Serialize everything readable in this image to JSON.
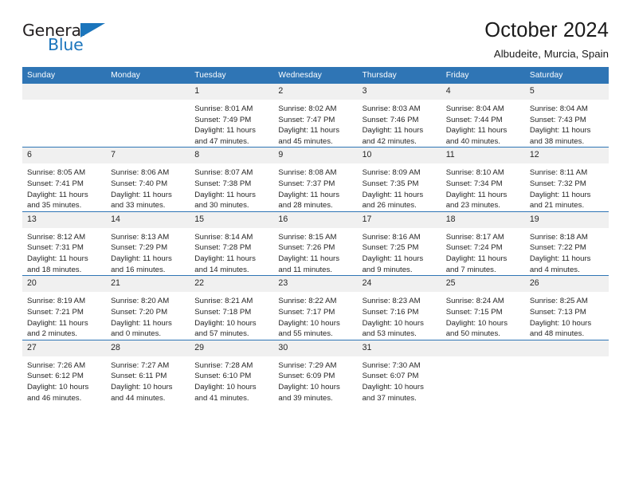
{
  "logo": {
    "word_top": "General",
    "word_bottom": "Blue",
    "triangle_color": "#1b75bc"
  },
  "header": {
    "title": "October 2024",
    "subtitle": "Albudeite, Murcia, Spain"
  },
  "colors": {
    "header_blue": "#2f75b5",
    "daynum_band": "#f0f0f0",
    "text": "#262626"
  },
  "weekday_headers": [
    "Sunday",
    "Monday",
    "Tuesday",
    "Wednesday",
    "Thursday",
    "Friday",
    "Saturday"
  ],
  "labels": {
    "sunrise": "Sunrise:",
    "sunset": "Sunset:",
    "daylight": "Daylight:"
  },
  "weeks": [
    [
      {
        "day": "",
        "empty": true
      },
      {
        "day": "",
        "empty": true
      },
      {
        "day": "1",
        "sunrise": "Sunrise: 8:01 AM",
        "sunset": "Sunset: 7:49 PM",
        "daylight1": "Daylight: 11 hours",
        "daylight2": "and 47 minutes."
      },
      {
        "day": "2",
        "sunrise": "Sunrise: 8:02 AM",
        "sunset": "Sunset: 7:47 PM",
        "daylight1": "Daylight: 11 hours",
        "daylight2": "and 45 minutes."
      },
      {
        "day": "3",
        "sunrise": "Sunrise: 8:03 AM",
        "sunset": "Sunset: 7:46 PM",
        "daylight1": "Daylight: 11 hours",
        "daylight2": "and 42 minutes."
      },
      {
        "day": "4",
        "sunrise": "Sunrise: 8:04 AM",
        "sunset": "Sunset: 7:44 PM",
        "daylight1": "Daylight: 11 hours",
        "daylight2": "and 40 minutes."
      },
      {
        "day": "5",
        "sunrise": "Sunrise: 8:04 AM",
        "sunset": "Sunset: 7:43 PM",
        "daylight1": "Daylight: 11 hours",
        "daylight2": "and 38 minutes."
      }
    ],
    [
      {
        "day": "6",
        "sunrise": "Sunrise: 8:05 AM",
        "sunset": "Sunset: 7:41 PM",
        "daylight1": "Daylight: 11 hours",
        "daylight2": "and 35 minutes."
      },
      {
        "day": "7",
        "sunrise": "Sunrise: 8:06 AM",
        "sunset": "Sunset: 7:40 PM",
        "daylight1": "Daylight: 11 hours",
        "daylight2": "and 33 minutes."
      },
      {
        "day": "8",
        "sunrise": "Sunrise: 8:07 AM",
        "sunset": "Sunset: 7:38 PM",
        "daylight1": "Daylight: 11 hours",
        "daylight2": "and 30 minutes."
      },
      {
        "day": "9",
        "sunrise": "Sunrise: 8:08 AM",
        "sunset": "Sunset: 7:37 PM",
        "daylight1": "Daylight: 11 hours",
        "daylight2": "and 28 minutes."
      },
      {
        "day": "10",
        "sunrise": "Sunrise: 8:09 AM",
        "sunset": "Sunset: 7:35 PM",
        "daylight1": "Daylight: 11 hours",
        "daylight2": "and 26 minutes."
      },
      {
        "day": "11",
        "sunrise": "Sunrise: 8:10 AM",
        "sunset": "Sunset: 7:34 PM",
        "daylight1": "Daylight: 11 hours",
        "daylight2": "and 23 minutes."
      },
      {
        "day": "12",
        "sunrise": "Sunrise: 8:11 AM",
        "sunset": "Sunset: 7:32 PM",
        "daylight1": "Daylight: 11 hours",
        "daylight2": "and 21 minutes."
      }
    ],
    [
      {
        "day": "13",
        "sunrise": "Sunrise: 8:12 AM",
        "sunset": "Sunset: 7:31 PM",
        "daylight1": "Daylight: 11 hours",
        "daylight2": "and 18 minutes."
      },
      {
        "day": "14",
        "sunrise": "Sunrise: 8:13 AM",
        "sunset": "Sunset: 7:29 PM",
        "daylight1": "Daylight: 11 hours",
        "daylight2": "and 16 minutes."
      },
      {
        "day": "15",
        "sunrise": "Sunrise: 8:14 AM",
        "sunset": "Sunset: 7:28 PM",
        "daylight1": "Daylight: 11 hours",
        "daylight2": "and 14 minutes."
      },
      {
        "day": "16",
        "sunrise": "Sunrise: 8:15 AM",
        "sunset": "Sunset: 7:26 PM",
        "daylight1": "Daylight: 11 hours",
        "daylight2": "and 11 minutes."
      },
      {
        "day": "17",
        "sunrise": "Sunrise: 8:16 AM",
        "sunset": "Sunset: 7:25 PM",
        "daylight1": "Daylight: 11 hours",
        "daylight2": "and 9 minutes."
      },
      {
        "day": "18",
        "sunrise": "Sunrise: 8:17 AM",
        "sunset": "Sunset: 7:24 PM",
        "daylight1": "Daylight: 11 hours",
        "daylight2": "and 7 minutes."
      },
      {
        "day": "19",
        "sunrise": "Sunrise: 8:18 AM",
        "sunset": "Sunset: 7:22 PM",
        "daylight1": "Daylight: 11 hours",
        "daylight2": "and 4 minutes."
      }
    ],
    [
      {
        "day": "20",
        "sunrise": "Sunrise: 8:19 AM",
        "sunset": "Sunset: 7:21 PM",
        "daylight1": "Daylight: 11 hours",
        "daylight2": "and 2 minutes."
      },
      {
        "day": "21",
        "sunrise": "Sunrise: 8:20 AM",
        "sunset": "Sunset: 7:20 PM",
        "daylight1": "Daylight: 11 hours",
        "daylight2": "and 0 minutes."
      },
      {
        "day": "22",
        "sunrise": "Sunrise: 8:21 AM",
        "sunset": "Sunset: 7:18 PM",
        "daylight1": "Daylight: 10 hours",
        "daylight2": "and 57 minutes."
      },
      {
        "day": "23",
        "sunrise": "Sunrise: 8:22 AM",
        "sunset": "Sunset: 7:17 PM",
        "daylight1": "Daylight: 10 hours",
        "daylight2": "and 55 minutes."
      },
      {
        "day": "24",
        "sunrise": "Sunrise: 8:23 AM",
        "sunset": "Sunset: 7:16 PM",
        "daylight1": "Daylight: 10 hours",
        "daylight2": "and 53 minutes."
      },
      {
        "day": "25",
        "sunrise": "Sunrise: 8:24 AM",
        "sunset": "Sunset: 7:15 PM",
        "daylight1": "Daylight: 10 hours",
        "daylight2": "and 50 minutes."
      },
      {
        "day": "26",
        "sunrise": "Sunrise: 8:25 AM",
        "sunset": "Sunset: 7:13 PM",
        "daylight1": "Daylight: 10 hours",
        "daylight2": "and 48 minutes."
      }
    ],
    [
      {
        "day": "27",
        "sunrise": "Sunrise: 7:26 AM",
        "sunset": "Sunset: 6:12 PM",
        "daylight1": "Daylight: 10 hours",
        "daylight2": "and 46 minutes."
      },
      {
        "day": "28",
        "sunrise": "Sunrise: 7:27 AM",
        "sunset": "Sunset: 6:11 PM",
        "daylight1": "Daylight: 10 hours",
        "daylight2": "and 44 minutes."
      },
      {
        "day": "29",
        "sunrise": "Sunrise: 7:28 AM",
        "sunset": "Sunset: 6:10 PM",
        "daylight1": "Daylight: 10 hours",
        "daylight2": "and 41 minutes."
      },
      {
        "day": "30",
        "sunrise": "Sunrise: 7:29 AM",
        "sunset": "Sunset: 6:09 PM",
        "daylight1": "Daylight: 10 hours",
        "daylight2": "and 39 minutes."
      },
      {
        "day": "31",
        "sunrise": "Sunrise: 7:30 AM",
        "sunset": "Sunset: 6:07 PM",
        "daylight1": "Daylight: 10 hours",
        "daylight2": "and 37 minutes."
      },
      {
        "day": "",
        "empty": true
      },
      {
        "day": "",
        "empty": true
      }
    ]
  ]
}
